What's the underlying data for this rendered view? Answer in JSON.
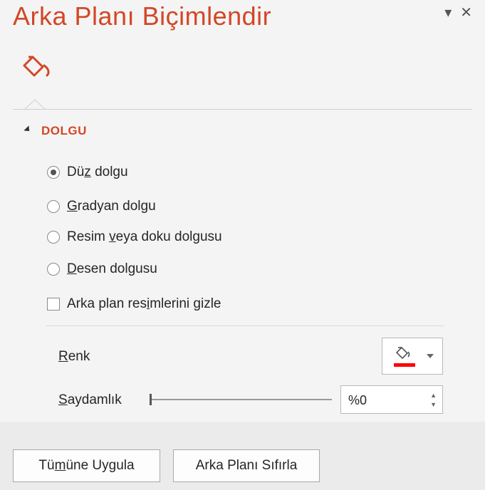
{
  "title": "Arka Planı Biçimlendir",
  "header_buttons": {
    "options_icon": "▾",
    "close_icon": "✕"
  },
  "section": {
    "label": "DOLGU"
  },
  "fill_options": [
    {
      "pre": "Dü",
      "key": "z",
      "post": " dolgu",
      "selected": true
    },
    {
      "pre": "",
      "key": "G",
      "post": "radyan dolgu",
      "selected": false
    },
    {
      "pre": "Resim ",
      "key": "v",
      "post": "eya doku dolgusu",
      "selected": false
    },
    {
      "pre": "",
      "key": "D",
      "post": "esen dolgusu",
      "selected": false
    }
  ],
  "hide_images": {
    "pre": "Arka plan res",
    "key": "i",
    "post": "mlerini gizle",
    "checked": false
  },
  "color": {
    "key": "R",
    "post": "enk",
    "swatch": "#ff0000"
  },
  "transparency": {
    "key": "S",
    "post": "aydamlık",
    "value": "%0",
    "level": 0
  },
  "buttons": {
    "apply_all": {
      "pre": "Tü",
      "key": "m",
      "post": "üne Uygula"
    },
    "reset": {
      "label": "Arka Planı Sıfırla"
    }
  },
  "colors": {
    "accent": "#d24726",
    "panel": "#f4f4f4"
  }
}
